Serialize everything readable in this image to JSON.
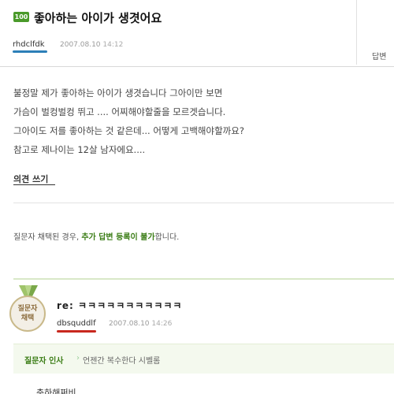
{
  "question": {
    "badge": "100",
    "title": "좋아하는 아이가 생겻어요",
    "author": "rhdclfdk",
    "date": "2007.08.10",
    "time": "14:12",
    "answer_label": "답변",
    "body_lines": [
      "불정말 제가 좋아하는 아이가 생겻습니다 그아이만 보면",
      "가슴이 벌컹벌컹 뛰고 .... 어찌해야할줄을 모르겟습니다.",
      "그아이도 저를 좋아하는 것 같은데... 어떻게 고백해야할까요?",
      "참고로 제나이는 12살 남자에요...."
    ],
    "comment_link": "의견 쓰기",
    "notice": {
      "prefix": "질문자 채택된 경우, ",
      "highlight": "추가 답변 등록이 불가",
      "suffix": "합니다."
    }
  },
  "answer": {
    "medal_line1": "질문자",
    "medal_line2": "채택",
    "title": "re: ㅋㅋㅋㅋㅋㅋㅋㅋㅋㅋㅋ",
    "author": "dbsquddlf",
    "date": "2007.08.10",
    "time": "14:26",
    "greeting_label": "질문자 인사",
    "greeting_sep": "›",
    "greeting_text": "언젠간 복수한다 시벨롬",
    "cutoff_text": "축하해쩌비"
  },
  "colors": {
    "green": "#3b7d16",
    "blue_underline": "#2c7fb8",
    "red_underline": "#c8281e"
  }
}
